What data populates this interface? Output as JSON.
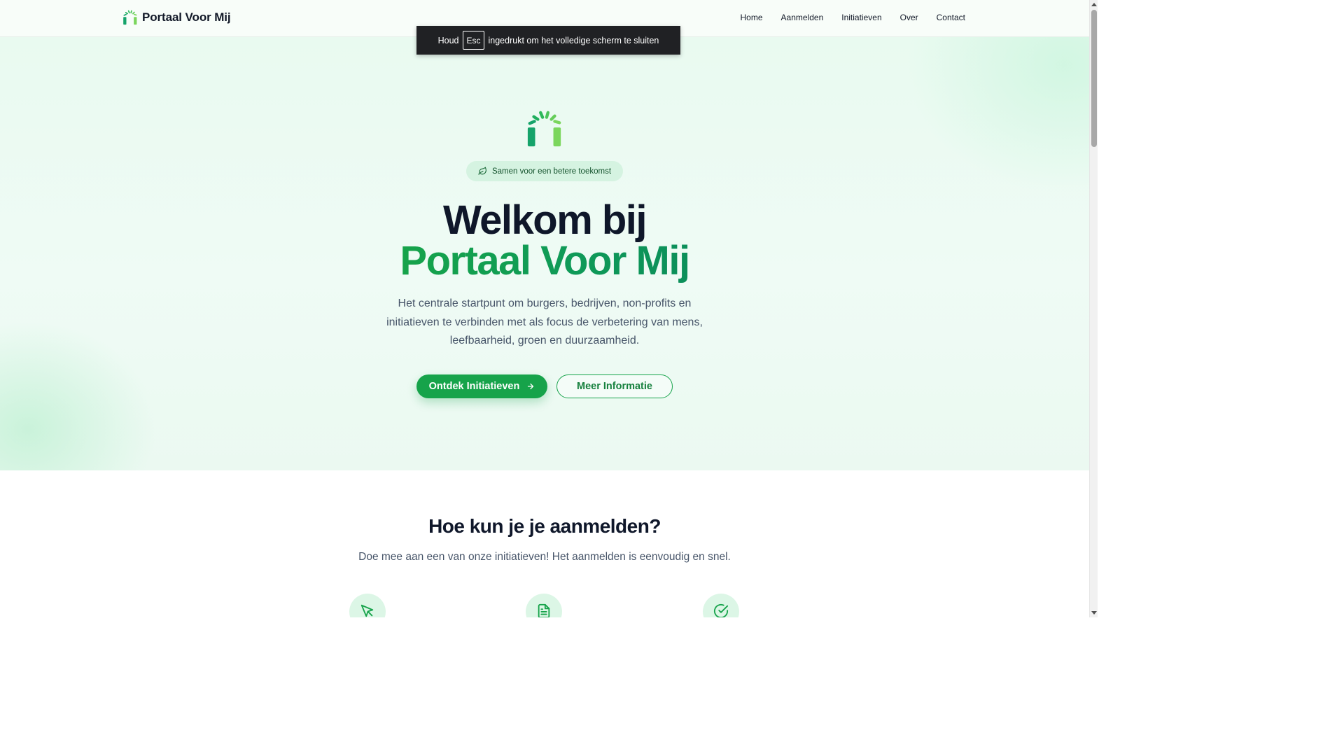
{
  "header": {
    "brand_name": "Portaal Voor Mij",
    "brand_logo_icon": "sprout-arch-icon",
    "nav": [
      "Home",
      "Aanmelden",
      "Initiatieven",
      "Over",
      "Contact"
    ]
  },
  "fullscreen_toast": {
    "before": "Houd",
    "key": "Esc",
    "after": "ingedrukt om het volledige scherm te sluiten"
  },
  "hero": {
    "logo_icon": "sprout-arch-icon",
    "tagline": "Samen voor een betere toekomst",
    "tagline_icon": "leaf-icon",
    "title_line1": "Welkom bij",
    "title_line2": "Portaal Voor Mij",
    "lead": "Het centrale startpunt om burgers, bedrijven, non-profits en initiatieven te verbinden met als focus de verbetering van mens, leefbaarheid, groen en duurzaamheid.",
    "primary_button": "Ontdek Initiatieven",
    "primary_button_icon": "arrow-right-icon",
    "secondary_button": "Meer Informatie"
  },
  "signup_section": {
    "title": "Hoe kun je je aanmelden?",
    "subtitle": "Doe mee aan een van onze initiatieven! Het aanmelden is eenvoudig en snel.",
    "step_icons": [
      "cursor-click-icon",
      "document-icon",
      "check-circle-icon"
    ]
  },
  "colors": {
    "accent": "#16a34a",
    "dark_text": "#0f172a",
    "muted_text": "#475569",
    "hero_bg": "#ecfaf2"
  }
}
